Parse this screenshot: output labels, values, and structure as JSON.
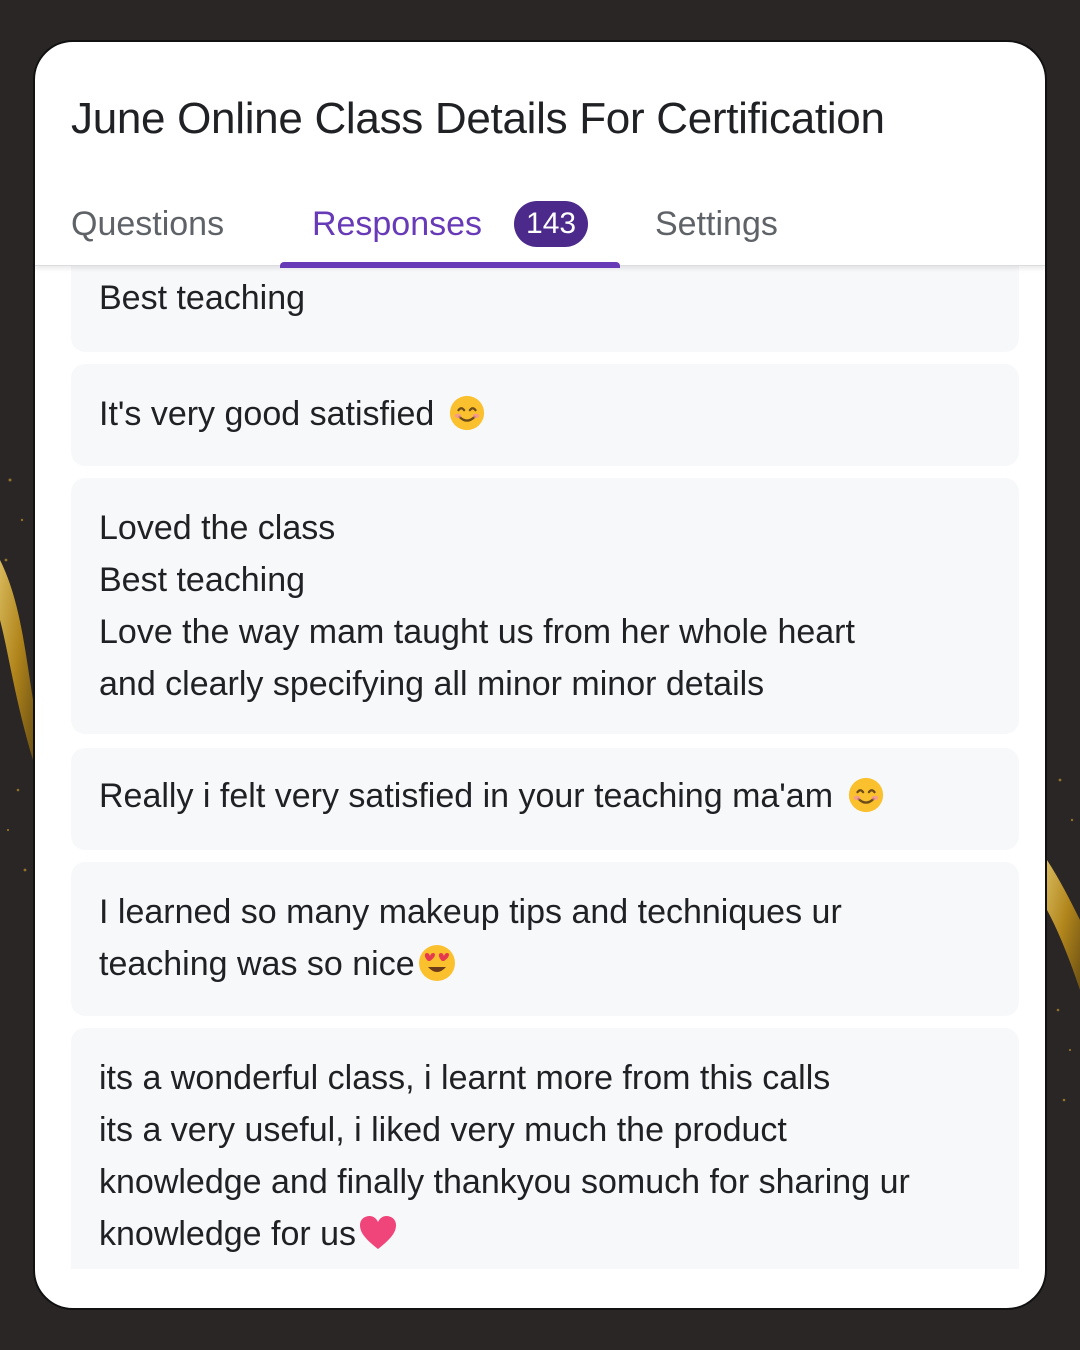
{
  "form": {
    "title": "June Online Class Details For Certification"
  },
  "tabs": {
    "questions": "Questions",
    "responses": "Responses",
    "responses_count": "143",
    "settings": "Settings",
    "active": "responses"
  },
  "colors": {
    "accent": "#673ab7",
    "badge": "#4c2a8c",
    "card_bg": "#f7f8fa"
  },
  "responses": [
    {
      "lines": [
        "Best teaching"
      ]
    },
    {
      "lines": [
        "It's very good satisfied"
      ],
      "emoji": "smiling-face-icon"
    },
    {
      "lines": [
        "Loved the class",
        "Best teaching",
        "Love the way mam taught us from her whole heart",
        "and clearly specifying all minor minor details"
      ]
    },
    {
      "lines": [
        "Really i felt very satisfied in your teaching ma'am"
      ],
      "emoji": "smiling-face-icon"
    },
    {
      "lines": [
        "I learned so many makeup tips and techniques ur",
        "teaching was so nice"
      ],
      "emoji": "heart-eyes-icon"
    },
    {
      "lines": [
        "its a wonderful class, i learnt more from this calls",
        "its a very useful, i liked very much the product",
        "knowledge and finally thankyou somuch for sharing ur",
        "knowledge for us"
      ],
      "emoji": "heart-icon"
    }
  ]
}
